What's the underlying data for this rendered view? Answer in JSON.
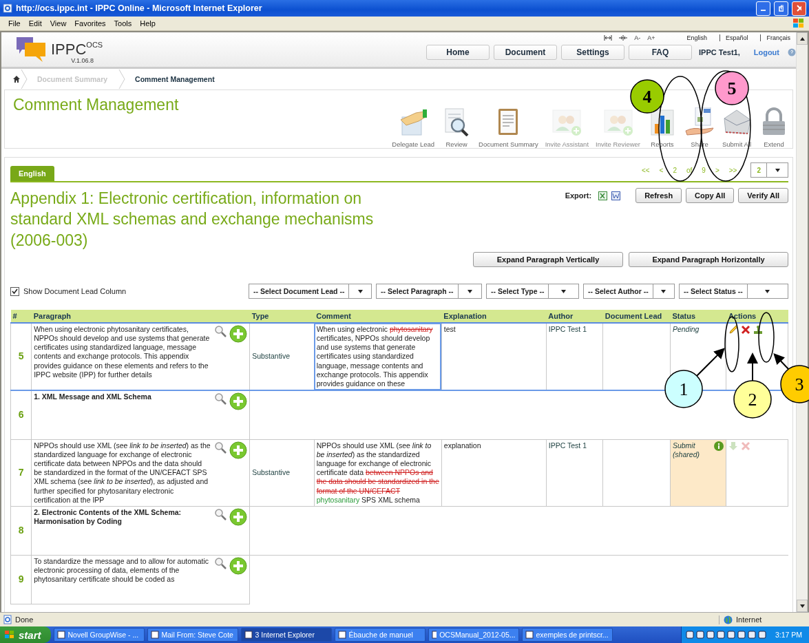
{
  "window": {
    "title": "http://ocs.ippc.int - IPPC Online - Microsoft Internet Explorer"
  },
  "menu": [
    "File",
    "Edit",
    "View",
    "Favorites",
    "Tools",
    "Help"
  ],
  "header": {
    "logo": "IPPC$^{OCS}$",
    "version": "V.1.06.8",
    "font_controls": [
      "A-",
      "A+"
    ],
    "languages": [
      "English",
      "Español",
      "Français"
    ],
    "nav": [
      "Home",
      "Document",
      "Settings",
      "FAQ"
    ],
    "user": "IPPC Test1,",
    "logout": "Logout"
  },
  "breadcrumb": [
    {
      "label": "Document Summary",
      "current": false
    },
    {
      "label": "Comment Management",
      "current": true
    }
  ],
  "page_title": "Comment Management",
  "toolbar": [
    {
      "kind": "delegate",
      "label": "Delegate Lead",
      "disabled": false
    },
    {
      "kind": "review",
      "label": "Review",
      "disabled": false
    },
    {
      "kind": "summary",
      "label": "Document Summary",
      "disabled": false
    },
    {
      "kind": "invite",
      "label": "Invite Assistant",
      "disabled": true
    },
    {
      "kind": "invite",
      "label": "Invite Reviewer",
      "disabled": true
    },
    {
      "kind": "reports",
      "label": "Reports",
      "disabled": false
    },
    {
      "kind": "share",
      "label": "Share",
      "disabled": false
    },
    {
      "kind": "submit",
      "label": "Submit All",
      "disabled": false
    },
    {
      "kind": "lock",
      "label": "Extend",
      "disabled": false
    }
  ],
  "language_tabs": [
    {
      "label": "English",
      "selected": true
    }
  ],
  "pager": {
    "items": [
      "<<",
      "<",
      "2",
      "of",
      "9",
      ">",
      ">>"
    ],
    "page_select": "2"
  },
  "document_title": "Appendix 1: Electronic certification, information on standard XML schemas and exchange mechanisms (2006-003)",
  "export_label": "Export:",
  "action_buttons": [
    "Refresh",
    "Copy All",
    "Verify All"
  ],
  "expand_buttons": [
    "Expand Paragraph Vertically",
    "Expand Paragraph Horizontally"
  ],
  "show_lead": {
    "label": "Show Document Lead Column",
    "checked": true
  },
  "filters": [
    "-- Select Document Lead --",
    "-- Select Paragraph --",
    "-- Select Type --",
    "-- Select Author --",
    "-- Select Status --"
  ],
  "table": {
    "columns": [
      "#",
      "Paragraph",
      "Type",
      "Comment",
      "Explanation",
      "Author",
      "Document Lead",
      "Status",
      "Actions"
    ],
    "rows": [
      {
        "number": "5",
        "kind": "text",
        "paragraph": "When using electronic phytosanitary certificates, NPPOs should develop and use systems that generate certificates using standardized language, message contents and exchange protocols. This appendix provides guidance on these elements and refers to the IPPC website (IPP) for further details",
        "comment": {
          "type": "Substantive",
          "segments": [
            {
              "kind": "normal",
              "text": "When using electronic "
            },
            {
              "kind": "deleted",
              "text": "phytosanitary"
            },
            {
              "kind": "normal",
              "text": " certificates, NPPOs should develop and use systems that generate certificates using standardized language, message contents and exchange protocols. This appendix provides guidance on these"
            }
          ],
          "explanation": "test",
          "author": "IPPC Test 1",
          "status": "Pending",
          "shared": false,
          "selected": true
        }
      },
      {
        "number": "6",
        "kind": "heading",
        "paragraph": "1. XML Message and XML Schema"
      },
      {
        "number": "7",
        "kind": "text",
        "paragraph": "NPPOs should use XML (see *link to be inserted*) as the standardized language for exchange of electronic certificate data between NPPOs and the data should be standardized in the format of the UN/CEFACT SPS XML schema (see *link to be inserted*), as adjusted and further specified for phytosanitary electronic certification at the IPP",
        "comment": {
          "type": "Substantive",
          "segments": [
            {
              "kind": "normal",
              "text": "NPPOs should use XML (see "
            },
            {
              "kind": "italic",
              "text": "link to be inserted"
            },
            {
              "kind": "normal",
              "text": ") as the standardized language for exchange of electronic certificate data "
            },
            {
              "kind": "deleted",
              "text": "between NPPOs and the data should be standardized in the format of the UN/CEFACT "
            },
            {
              "kind": "inserted",
              "text": "phytosanitary"
            },
            {
              "kind": "normal",
              "text": " SPS XML schema"
            }
          ],
          "explanation": "explanation",
          "author": "IPPC Test 1",
          "status": "Submit (shared)",
          "shared": true,
          "selected": false
        }
      },
      {
        "number": "8",
        "kind": "heading",
        "paragraph": "2. Electronic Contents of the XML Schema: Harmonisation by Coding"
      },
      {
        "number": "9",
        "kind": "text",
        "paragraph": "To standardize the message and to allow for automatic electronic processing of data, elements of the phytosanitary certificate should be coded as"
      }
    ]
  },
  "annotations": [
    {
      "label": "1",
      "color": "#ccffff"
    },
    {
      "label": "2",
      "color": "#ffff99"
    },
    {
      "label": "3",
      "color": "#ffcc00"
    },
    {
      "label": "4",
      "color": "#99cc00"
    },
    {
      "label": "5",
      "color": "#ff99cc"
    }
  ],
  "status_bar": {
    "text": "Done",
    "zone": "Internet"
  },
  "taskbar": {
    "start": "start",
    "items": [
      {
        "label": "Novell GroupWise - ...",
        "selected": false
      },
      {
        "label": "Mail From: Steve Cote",
        "selected": false
      },
      {
        "label": "3 Internet Explorer",
        "selected": true
      },
      {
        "label": "Ébauche de manuel",
        "selected": false
      },
      {
        "label": "OCSManual_2012-05...",
        "selected": false
      },
      {
        "label": "exemples de printscr...",
        "selected": false
      }
    ],
    "clock": "3:17 PM"
  }
}
